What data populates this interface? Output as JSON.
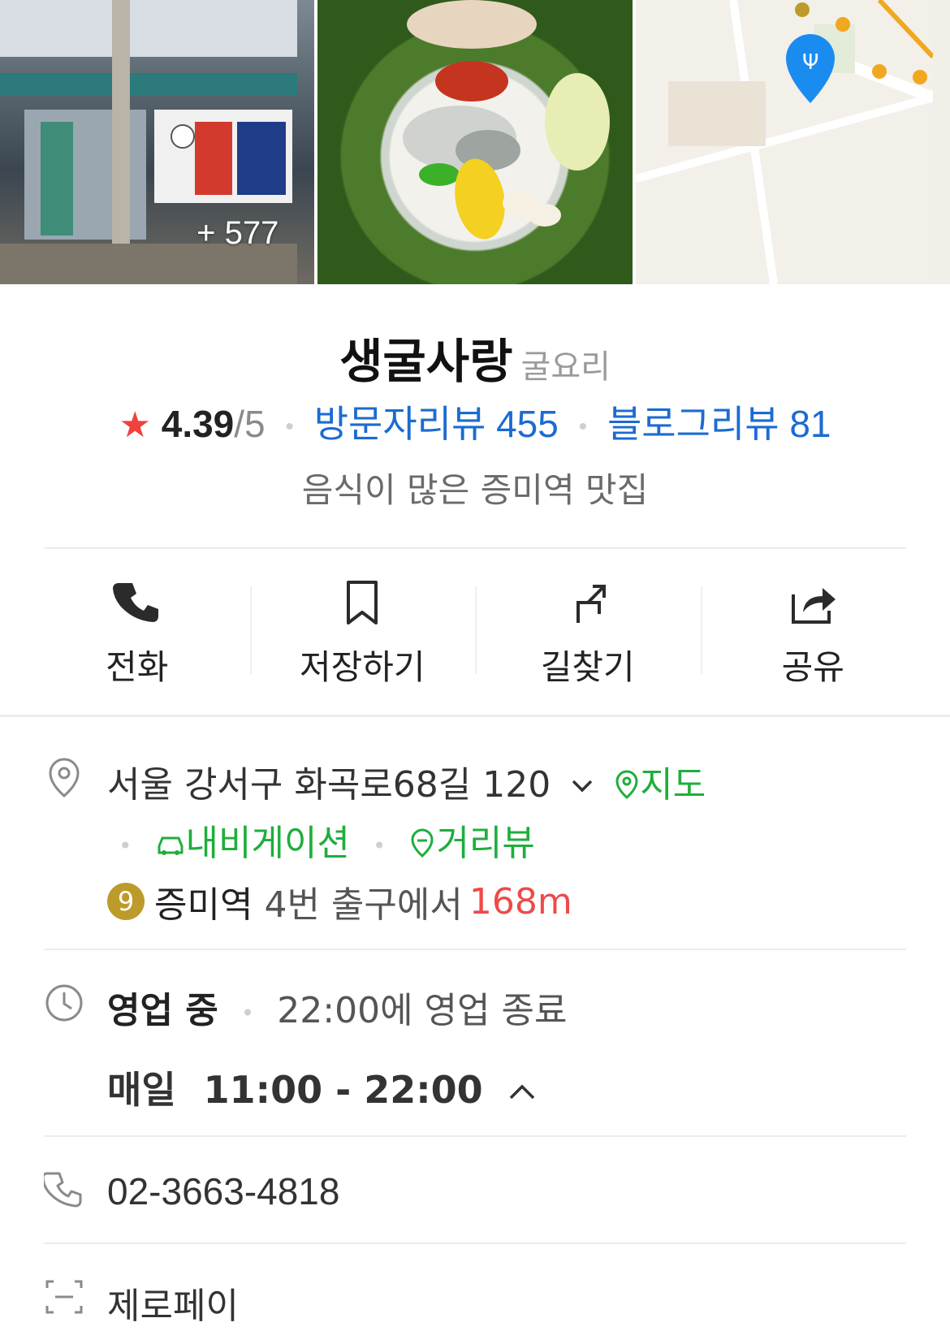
{
  "photos": {
    "more_count": "+ 577"
  },
  "place": {
    "name": "생굴사랑",
    "category": "굴요리",
    "rating": "4.39",
    "rating_max": "/5",
    "visitor_reviews": "방문자리뷰 455",
    "blog_reviews": "블로그리뷰 81",
    "description": "음식이 많은 증미역 맛집"
  },
  "actions": [
    {
      "label": "전화",
      "icon": "phone-icon"
    },
    {
      "label": "저장하기",
      "icon": "bookmark-icon"
    },
    {
      "label": "길찾기",
      "icon": "directions-icon"
    },
    {
      "label": "공유",
      "icon": "share-icon"
    }
  ],
  "address": {
    "text": "서울 강서구 화곡로68길 120",
    "map_link": "지도",
    "navigation_link": "내비게이션",
    "street_view_link": "거리뷰"
  },
  "subway": {
    "line": "9",
    "station": "증미역",
    "exit_text": "4번 출구에서",
    "distance": "168m"
  },
  "hours": {
    "status": "영업 중",
    "closing": "22:00에 영업 종료",
    "daily_label": "매일",
    "daily_hours": "11:00 - 22:00"
  },
  "phone": "02-3663-4818",
  "payment": "제로페이",
  "colors": {
    "link_blue": "#1c6bd1",
    "green": "#1fae3c",
    "star_red": "#f0413c",
    "distance_red": "#ee4a4a",
    "line9_gold": "#bd9b2a",
    "map_pin_blue": "#1a8cf0"
  }
}
